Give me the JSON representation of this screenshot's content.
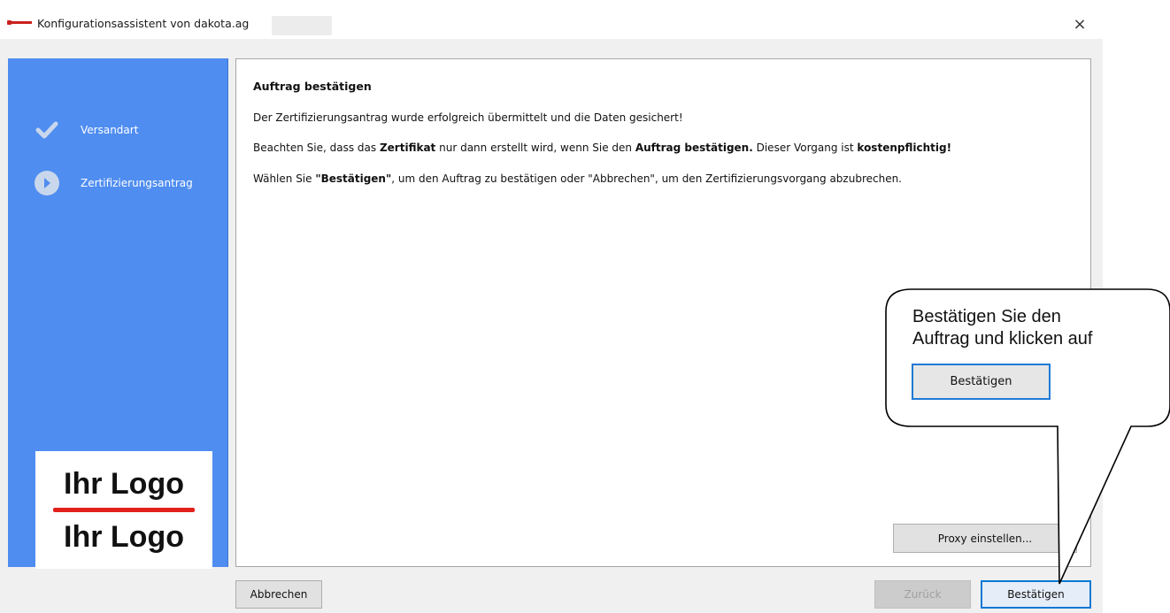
{
  "window": {
    "title": "Konfigurationsassistent von dakota.ag",
    "close_label": "×"
  },
  "sidebar": {
    "steps": [
      {
        "label": "Versandart",
        "icon": "check-icon"
      },
      {
        "label": "Zertifizierungsantrag",
        "icon": "arrow-right-circle-icon"
      }
    ],
    "logo": {
      "line1": "Ihr Logo",
      "line2": "Ihr Logo"
    }
  },
  "content": {
    "heading": "Auftrag bestätigen",
    "line1": "Der Zertifizierungsantrag wurde erfolgreich übermittelt und die Daten gesichert!",
    "line2": {
      "a": "Beachten Sie, dass das ",
      "b": "Zertifikat",
      "c": " nur dann erstellt wird, wenn Sie den ",
      "d": "Auftrag bestätigen.",
      "e": " Dieser Vorgang ist ",
      "f": "kostenpflichtig!"
    },
    "line3": {
      "a": "Wählen Sie ",
      "b": "\"Bestätigen\"",
      "c": ", um den Auftrag zu bestätigen oder \"Abbrechen\", um den Zertifizierungsvorgang abzubrechen."
    },
    "proxy_button": "Proxy einstellen..."
  },
  "footer": {
    "cancel": "Abbrechen",
    "back": "Zurück",
    "confirm": "Bestätigen"
  },
  "callout": {
    "line1": "Bestätigen Sie den",
    "line2": "Auftrag und klicken auf",
    "button": "Bestätigen"
  },
  "colors": {
    "sidebar": "#4f8df0",
    "accent": "#0a78d4",
    "logo_bar": "#e2201c"
  }
}
